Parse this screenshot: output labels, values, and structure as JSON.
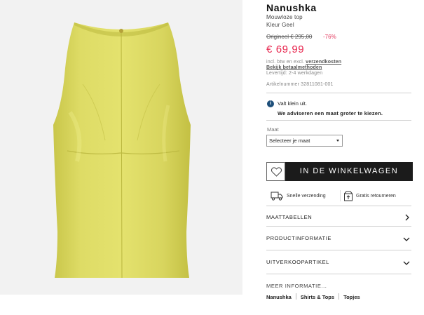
{
  "product": {
    "brand": "Nanushka",
    "name": "Mouwloze top",
    "color": "Kleur Geel",
    "original_price": "Origineel € 295,00",
    "discount": "-76%",
    "price": "€ 69,99",
    "shipping_prefix": "incl. btw en excl.",
    "shipping_link": "verzendkosten",
    "payment_link": "Bekijk betaalmethoden",
    "delivery": "Levertijd: 2-4 werkdagen",
    "article_number": "Artikelnummer 32811081-001"
  },
  "fit": {
    "note": "Valt klein uit.",
    "advice": "We adviseren een maat groter te kiezen."
  },
  "size": {
    "label": "Maat",
    "selected": "Selecteer je maat"
  },
  "actions": {
    "add_to_cart": "IN DE WINKELWAGEN"
  },
  "usps": [
    {
      "label": "Snelle verzending",
      "icon": "truck-icon"
    },
    {
      "label": "Gratis retourneren",
      "icon": "return-box-icon"
    }
  ],
  "accordions": [
    {
      "label": "MAATTABELLEN",
      "icon": "chevron-right-icon"
    },
    {
      "label": "PRODUCTINFORMATIE",
      "icon": "chevron-down-icon"
    },
    {
      "label": "UITVERKOOPARTIKEL",
      "icon": "chevron-down-icon"
    }
  ],
  "more_info": {
    "title": "MEER INFORMATIE...",
    "links": [
      "Nanushka",
      "Shirts & Tops",
      "Topjes"
    ]
  },
  "colors": {
    "price": "#e8274f",
    "button": "#1b1b1b",
    "garment": "#d9d95a"
  }
}
